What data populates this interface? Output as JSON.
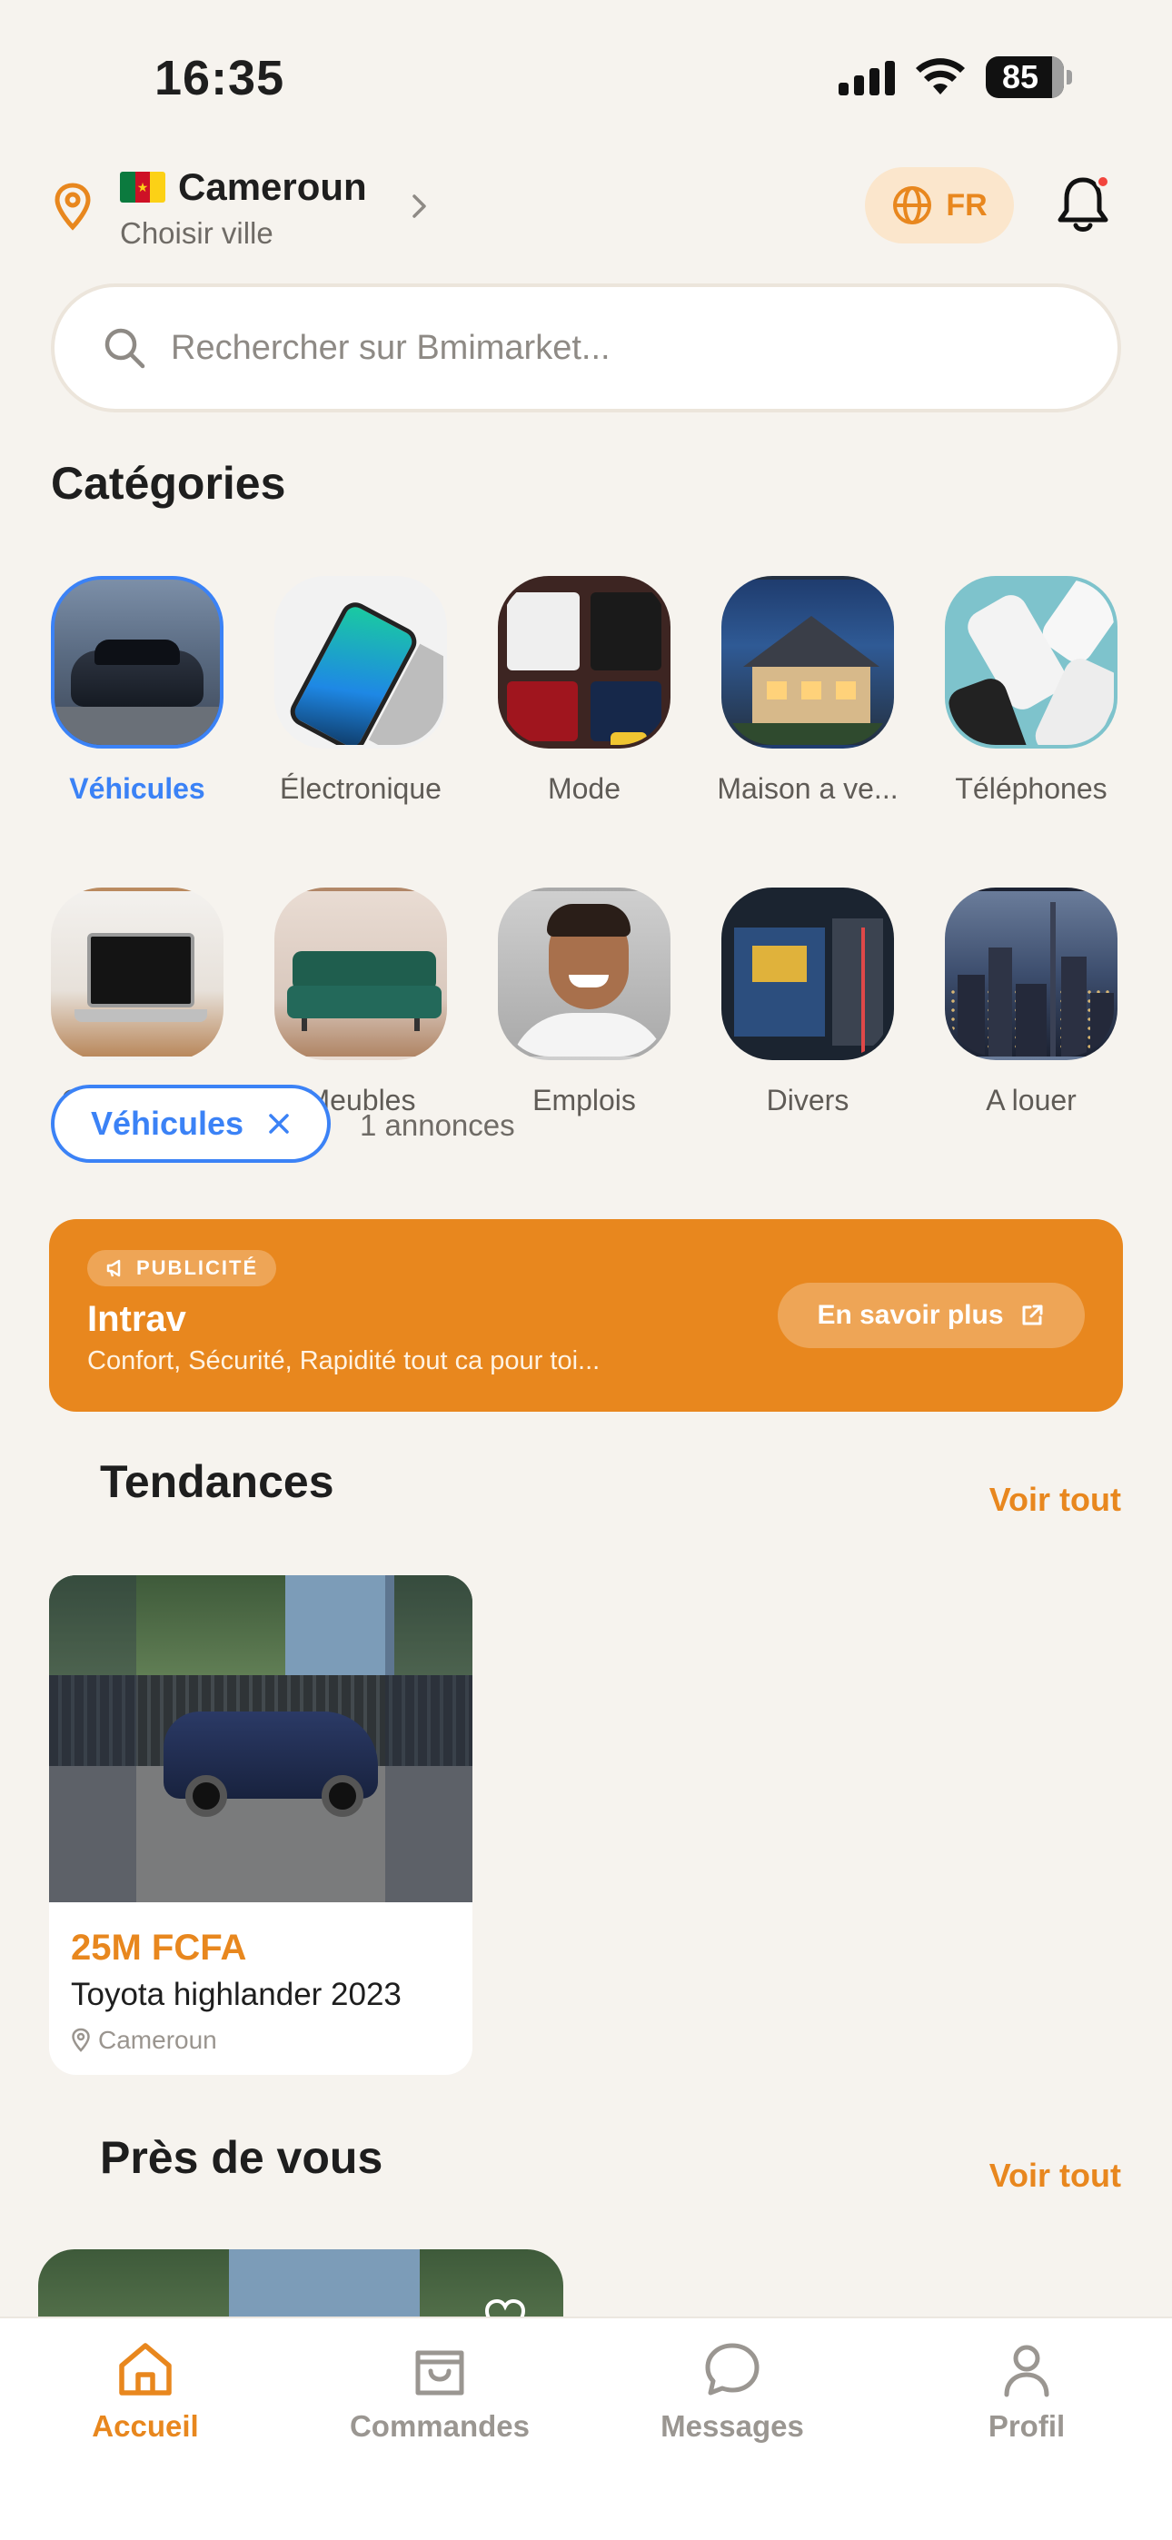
{
  "status_bar": {
    "time": "16:35",
    "battery": "85",
    "icons": [
      "signal-icon",
      "wifi-icon",
      "battery-icon"
    ]
  },
  "header": {
    "country": "Cameroun",
    "city_prompt": "Choisir ville",
    "language": "FR",
    "icons": [
      "location-pin-icon",
      "cameroon-flag-icon",
      "chevron-right-icon",
      "globe-icon",
      "bell-icon"
    ]
  },
  "search": {
    "placeholder": "Rechercher sur Bmimarket..."
  },
  "categories": {
    "title": "Catégories",
    "items": [
      {
        "label": "Véhicules",
        "active": true
      },
      {
        "label": "Électronique"
      },
      {
        "label": "Mode"
      },
      {
        "label": "Maison a ve..."
      },
      {
        "label": "Téléphones"
      },
      {
        "label": "Ordinateurs"
      },
      {
        "label": "Meubles"
      },
      {
        "label": "Emplois"
      },
      {
        "label": "Divers"
      },
      {
        "label": "A louer"
      }
    ]
  },
  "filter": {
    "chip_label": "Véhicules",
    "result_count": "1 annonces"
  },
  "ad": {
    "badge": "PUBLICITÉ",
    "title": "Intrav",
    "description": "Confort, Sécurité, Rapidité tout ca pour toi...",
    "cta": "En savoir plus"
  },
  "trending": {
    "title": "Tendances",
    "see_all": "Voir tout",
    "products": [
      {
        "price": "25M FCFA",
        "title": "Toyota highlander 2023",
        "location": "Cameroun"
      }
    ]
  },
  "nearby": {
    "title": "Près de vous",
    "see_all": "Voir tout"
  },
  "bottom_nav": {
    "items": [
      {
        "label": "Accueil",
        "active": true
      },
      {
        "label": "Commandes"
      },
      {
        "label": "Messages"
      },
      {
        "label": "Profil"
      }
    ]
  },
  "colors": {
    "accent": "#E8871E",
    "active_blue": "#3B82F6",
    "background": "#F6F3EE"
  }
}
